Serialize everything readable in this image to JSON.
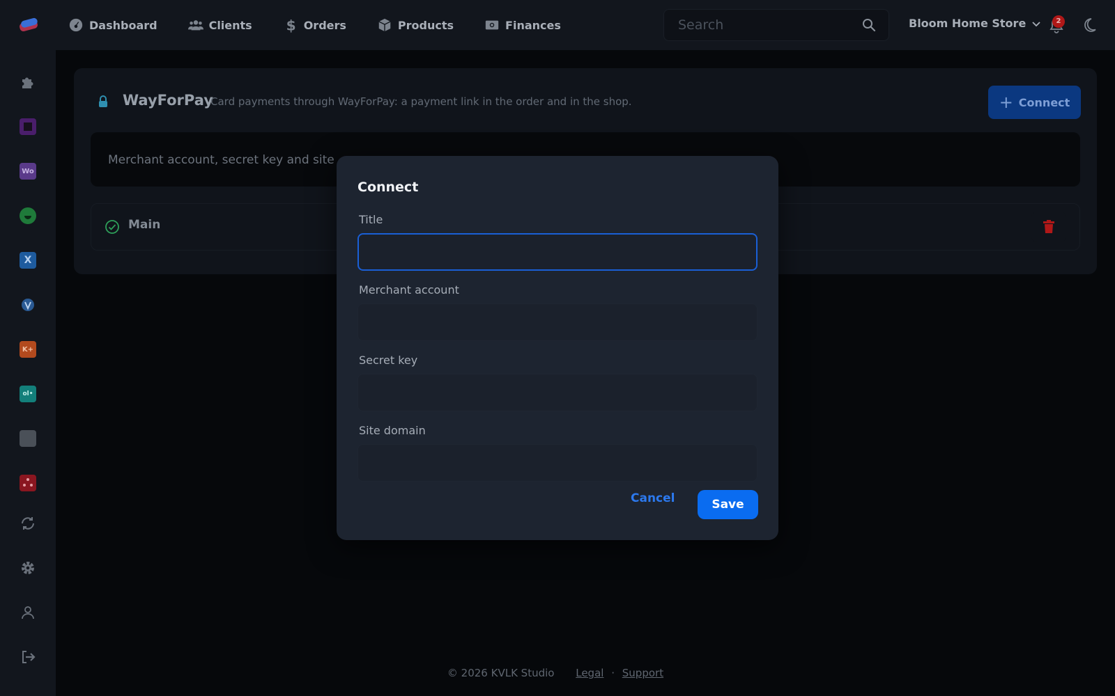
{
  "nav": {
    "items": [
      {
        "label": "Dashboard",
        "icon": "gauge-icon"
      },
      {
        "label": "Clients",
        "icon": "users-icon"
      },
      {
        "label": "Orders",
        "icon": "dollar-icon"
      },
      {
        "label": "Products",
        "icon": "box-icon"
      },
      {
        "label": "Finances",
        "icon": "money-icon"
      }
    ],
    "search_placeholder": "Search",
    "store_name": "Bloom Home Store",
    "notification_count": "2"
  },
  "sidebar": {
    "icons": [
      "puzzle-icon",
      "square-app-icon",
      "woo-icon",
      "smile-app-icon",
      "x-app-icon",
      "shield-app-icon",
      "k-plus-app-icon",
      "ol-app-icon",
      "gray-app-icon",
      "red-app-icon",
      "sync-icon",
      "gear-icon",
      "user-icon",
      "logout-icon"
    ],
    "woo_label": "Wo",
    "x_label": "X",
    "k_label": "K+",
    "ol_label": "ol•"
  },
  "integration": {
    "title": "WayForPay",
    "subtitle": "Card payments through WayForPay: a payment link in the order and in the shop.",
    "connect_label": "Connect",
    "info_text": "Merchant account, secret key and site",
    "connection_name": "Main"
  },
  "modal": {
    "title": "Connect",
    "fields": [
      {
        "label": "Title",
        "value": ""
      },
      {
        "label": "Merchant account",
        "value": ""
      },
      {
        "label": "Secret key",
        "value": ""
      },
      {
        "label": "Site domain",
        "value": ""
      }
    ],
    "cancel_label": "Cancel",
    "save_label": "Save"
  },
  "footer": {
    "copyright": "© 2026 KVLK Studio",
    "legal": "Legal",
    "separator": "·",
    "support": "Support"
  },
  "colors": {
    "accent": "#0a6cf0",
    "danger": "#b01818",
    "success": "#2ea05a"
  }
}
